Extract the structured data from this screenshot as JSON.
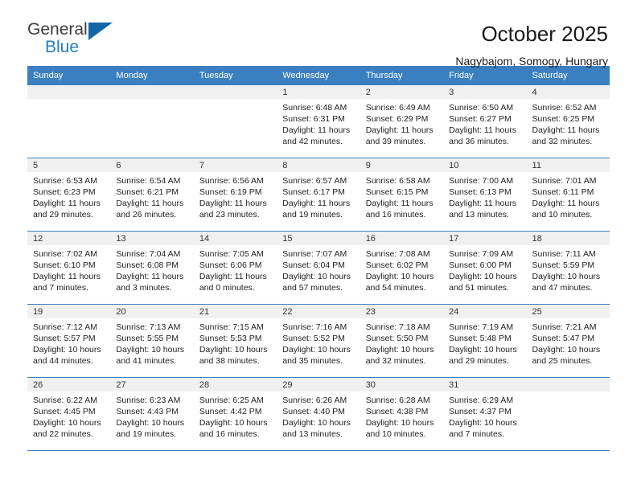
{
  "logo": {
    "line1": "General",
    "line2": "Blue",
    "triangle_color": "#1166aa",
    "blue_color": "#1f7fc4"
  },
  "header": {
    "title": "October 2025",
    "subtitle": "Nagybajom, Somogy, Hungary"
  },
  "theme": {
    "header_bg": "#3a7fbf",
    "daynum_bg": "#f0f0f0",
    "text": "#222222"
  },
  "calendar": {
    "weekday_headers": [
      "Sunday",
      "Monday",
      "Tuesday",
      "Wednesday",
      "Thursday",
      "Friday",
      "Saturday"
    ],
    "labels": {
      "sunrise": "Sunrise:",
      "sunset": "Sunset:",
      "daylight": "Daylight:"
    },
    "weeks": [
      [
        {
          "day": "",
          "empty": true,
          "sunrise": "",
          "sunset": "",
          "daylight_1": "",
          "daylight_2": ""
        },
        {
          "day": "",
          "empty": true,
          "sunrise": "",
          "sunset": "",
          "daylight_1": "",
          "daylight_2": ""
        },
        {
          "day": "",
          "empty": true,
          "sunrise": "",
          "sunset": "",
          "daylight_1": "",
          "daylight_2": ""
        },
        {
          "day": "1",
          "empty": false,
          "sunrise": "Sunrise: 6:48 AM",
          "sunset": "Sunset: 6:31 PM",
          "daylight_1": "Daylight: 11 hours",
          "daylight_2": "and 42 minutes."
        },
        {
          "day": "2",
          "empty": false,
          "sunrise": "Sunrise: 6:49 AM",
          "sunset": "Sunset: 6:29 PM",
          "daylight_1": "Daylight: 11 hours",
          "daylight_2": "and 39 minutes."
        },
        {
          "day": "3",
          "empty": false,
          "sunrise": "Sunrise: 6:50 AM",
          "sunset": "Sunset: 6:27 PM",
          "daylight_1": "Daylight: 11 hours",
          "daylight_2": "and 36 minutes."
        },
        {
          "day": "4",
          "empty": false,
          "sunrise": "Sunrise: 6:52 AM",
          "sunset": "Sunset: 6:25 PM",
          "daylight_1": "Daylight: 11 hours",
          "daylight_2": "and 32 minutes."
        }
      ],
      [
        {
          "day": "5",
          "empty": false,
          "sunrise": "Sunrise: 6:53 AM",
          "sunset": "Sunset: 6:23 PM",
          "daylight_1": "Daylight: 11 hours",
          "daylight_2": "and 29 minutes."
        },
        {
          "day": "6",
          "empty": false,
          "sunrise": "Sunrise: 6:54 AM",
          "sunset": "Sunset: 6:21 PM",
          "daylight_1": "Daylight: 11 hours",
          "daylight_2": "and 26 minutes."
        },
        {
          "day": "7",
          "empty": false,
          "sunrise": "Sunrise: 6:56 AM",
          "sunset": "Sunset: 6:19 PM",
          "daylight_1": "Daylight: 11 hours",
          "daylight_2": "and 23 minutes."
        },
        {
          "day": "8",
          "empty": false,
          "sunrise": "Sunrise: 6:57 AM",
          "sunset": "Sunset: 6:17 PM",
          "daylight_1": "Daylight: 11 hours",
          "daylight_2": "and 19 minutes."
        },
        {
          "day": "9",
          "empty": false,
          "sunrise": "Sunrise: 6:58 AM",
          "sunset": "Sunset: 6:15 PM",
          "daylight_1": "Daylight: 11 hours",
          "daylight_2": "and 16 minutes."
        },
        {
          "day": "10",
          "empty": false,
          "sunrise": "Sunrise: 7:00 AM",
          "sunset": "Sunset: 6:13 PM",
          "daylight_1": "Daylight: 11 hours",
          "daylight_2": "and 13 minutes."
        },
        {
          "day": "11",
          "empty": false,
          "sunrise": "Sunrise: 7:01 AM",
          "sunset": "Sunset: 6:11 PM",
          "daylight_1": "Daylight: 11 hours",
          "daylight_2": "and 10 minutes."
        }
      ],
      [
        {
          "day": "12",
          "empty": false,
          "sunrise": "Sunrise: 7:02 AM",
          "sunset": "Sunset: 6:10 PM",
          "daylight_1": "Daylight: 11 hours",
          "daylight_2": "and 7 minutes."
        },
        {
          "day": "13",
          "empty": false,
          "sunrise": "Sunrise: 7:04 AM",
          "sunset": "Sunset: 6:08 PM",
          "daylight_1": "Daylight: 11 hours",
          "daylight_2": "and 3 minutes."
        },
        {
          "day": "14",
          "empty": false,
          "sunrise": "Sunrise: 7:05 AM",
          "sunset": "Sunset: 6:06 PM",
          "daylight_1": "Daylight: 11 hours",
          "daylight_2": "and 0 minutes."
        },
        {
          "day": "15",
          "empty": false,
          "sunrise": "Sunrise: 7:07 AM",
          "sunset": "Sunset: 6:04 PM",
          "daylight_1": "Daylight: 10 hours",
          "daylight_2": "and 57 minutes."
        },
        {
          "day": "16",
          "empty": false,
          "sunrise": "Sunrise: 7:08 AM",
          "sunset": "Sunset: 6:02 PM",
          "daylight_1": "Daylight: 10 hours",
          "daylight_2": "and 54 minutes."
        },
        {
          "day": "17",
          "empty": false,
          "sunrise": "Sunrise: 7:09 AM",
          "sunset": "Sunset: 6:00 PM",
          "daylight_1": "Daylight: 10 hours",
          "daylight_2": "and 51 minutes."
        },
        {
          "day": "18",
          "empty": false,
          "sunrise": "Sunrise: 7:11 AM",
          "sunset": "Sunset: 5:59 PM",
          "daylight_1": "Daylight: 10 hours",
          "daylight_2": "and 47 minutes."
        }
      ],
      [
        {
          "day": "19",
          "empty": false,
          "sunrise": "Sunrise: 7:12 AM",
          "sunset": "Sunset: 5:57 PM",
          "daylight_1": "Daylight: 10 hours",
          "daylight_2": "and 44 minutes."
        },
        {
          "day": "20",
          "empty": false,
          "sunrise": "Sunrise: 7:13 AM",
          "sunset": "Sunset: 5:55 PM",
          "daylight_1": "Daylight: 10 hours",
          "daylight_2": "and 41 minutes."
        },
        {
          "day": "21",
          "empty": false,
          "sunrise": "Sunrise: 7:15 AM",
          "sunset": "Sunset: 5:53 PM",
          "daylight_1": "Daylight: 10 hours",
          "daylight_2": "and 38 minutes."
        },
        {
          "day": "22",
          "empty": false,
          "sunrise": "Sunrise: 7:16 AM",
          "sunset": "Sunset: 5:52 PM",
          "daylight_1": "Daylight: 10 hours",
          "daylight_2": "and 35 minutes."
        },
        {
          "day": "23",
          "empty": false,
          "sunrise": "Sunrise: 7:18 AM",
          "sunset": "Sunset: 5:50 PM",
          "daylight_1": "Daylight: 10 hours",
          "daylight_2": "and 32 minutes."
        },
        {
          "day": "24",
          "empty": false,
          "sunrise": "Sunrise: 7:19 AM",
          "sunset": "Sunset: 5:48 PM",
          "daylight_1": "Daylight: 10 hours",
          "daylight_2": "and 29 minutes."
        },
        {
          "day": "25",
          "empty": false,
          "sunrise": "Sunrise: 7:21 AM",
          "sunset": "Sunset: 5:47 PM",
          "daylight_1": "Daylight: 10 hours",
          "daylight_2": "and 25 minutes."
        }
      ],
      [
        {
          "day": "26",
          "empty": false,
          "sunrise": "Sunrise: 6:22 AM",
          "sunset": "Sunset: 4:45 PM",
          "daylight_1": "Daylight: 10 hours",
          "daylight_2": "and 22 minutes."
        },
        {
          "day": "27",
          "empty": false,
          "sunrise": "Sunrise: 6:23 AM",
          "sunset": "Sunset: 4:43 PM",
          "daylight_1": "Daylight: 10 hours",
          "daylight_2": "and 19 minutes."
        },
        {
          "day": "28",
          "empty": false,
          "sunrise": "Sunrise: 6:25 AM",
          "sunset": "Sunset: 4:42 PM",
          "daylight_1": "Daylight: 10 hours",
          "daylight_2": "and 16 minutes."
        },
        {
          "day": "29",
          "empty": false,
          "sunrise": "Sunrise: 6:26 AM",
          "sunset": "Sunset: 4:40 PM",
          "daylight_1": "Daylight: 10 hours",
          "daylight_2": "and 13 minutes."
        },
        {
          "day": "30",
          "empty": false,
          "sunrise": "Sunrise: 6:28 AM",
          "sunset": "Sunset: 4:38 PM",
          "daylight_1": "Daylight: 10 hours",
          "daylight_2": "and 10 minutes."
        },
        {
          "day": "31",
          "empty": false,
          "sunrise": "Sunrise: 6:29 AM",
          "sunset": "Sunset: 4:37 PM",
          "daylight_1": "Daylight: 10 hours",
          "daylight_2": "and 7 minutes."
        },
        {
          "day": "",
          "empty": true,
          "sunrise": "",
          "sunset": "",
          "daylight_1": "",
          "daylight_2": ""
        }
      ]
    ]
  }
}
